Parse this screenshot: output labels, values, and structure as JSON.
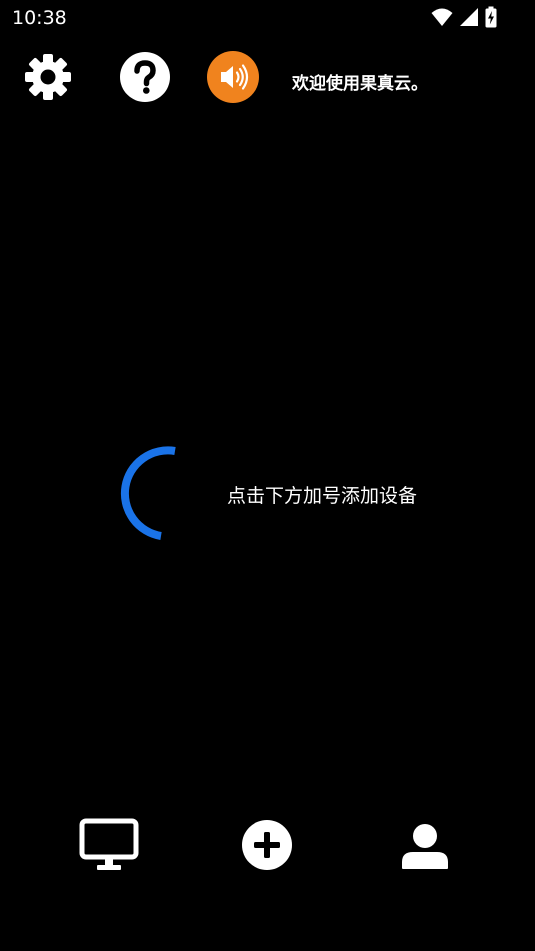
{
  "status_bar": {
    "time": "10:38",
    "icons": [
      "wifi-icon",
      "cell-signal-icon",
      "battery-charging-icon"
    ]
  },
  "toolbar": {
    "settings_icon": "gear-icon",
    "help_icon": "question-mark-icon",
    "sound_icon": "speaker-icon",
    "welcome_text": "欢迎使用果真云。"
  },
  "main": {
    "empty_hint": "点击下方加号添加设备"
  },
  "bottom_nav": {
    "items": [
      {
        "icon": "monitor-icon"
      },
      {
        "icon": "plus-circle-icon"
      },
      {
        "icon": "user-icon"
      }
    ]
  },
  "colors": {
    "background": "#000000",
    "accent_orange": "#F0831E",
    "spinner_blue": "#1A73E8",
    "foreground": "#FFFFFF"
  }
}
